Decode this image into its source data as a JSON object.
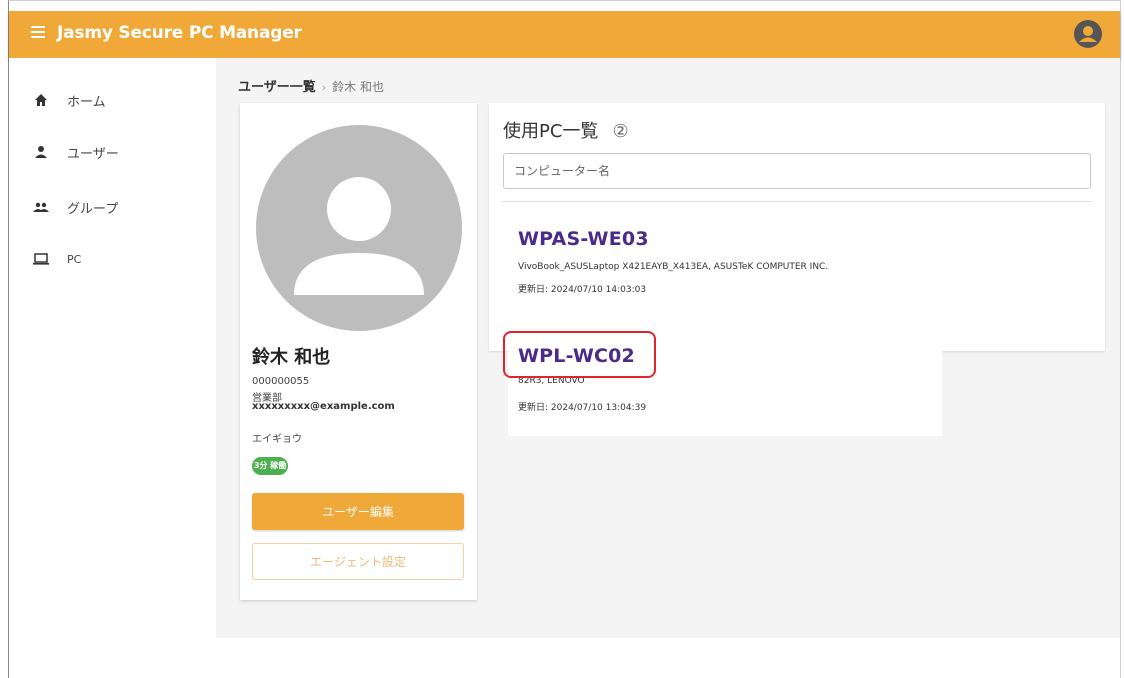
{
  "app": {
    "title": "Jasmy Secure PC Manager"
  },
  "sidebar": {
    "items": [
      {
        "label": "ホーム",
        "icon": "home-icon"
      },
      {
        "label": "ユーザー",
        "icon": "person-icon"
      },
      {
        "label": "グループ",
        "icon": "group-icon"
      },
      {
        "label": "PC",
        "icon": "laptop-icon"
      }
    ]
  },
  "breadcrumb": {
    "parent": "ユーザー一覧",
    "separator": "›",
    "current": "鈴木 和也"
  },
  "user": {
    "name": "鈴木 和也",
    "id": "000000055",
    "department": "営業部",
    "email": "xxxxxxxxx@example.com",
    "kana": "エイギョウ",
    "status": "3分 稼働",
    "edit_button": "ユーザー編集",
    "agent_button": "エージェント設定"
  },
  "pc_list": {
    "title": "使用PC一覧",
    "marker": "②",
    "search_placeholder": "コンピューター名",
    "items": [
      {
        "name": "WPAS-WE03",
        "model": "VivoBook_ASUSLaptop X421EAYB_X413EA, ASUSTeK COMPUTER INC.",
        "updated": "更新日: 2024/07/10 14:03:03"
      },
      {
        "name": "WPL-WC02",
        "model": "82R3, LENOVO",
        "updated": "更新日: 2024/07/10 13:04:39"
      }
    ]
  },
  "colors": {
    "appbar": "#f0a838",
    "pc_name": "#4b2a8a",
    "highlight": "#e0242c",
    "status": "#4caf50"
  }
}
